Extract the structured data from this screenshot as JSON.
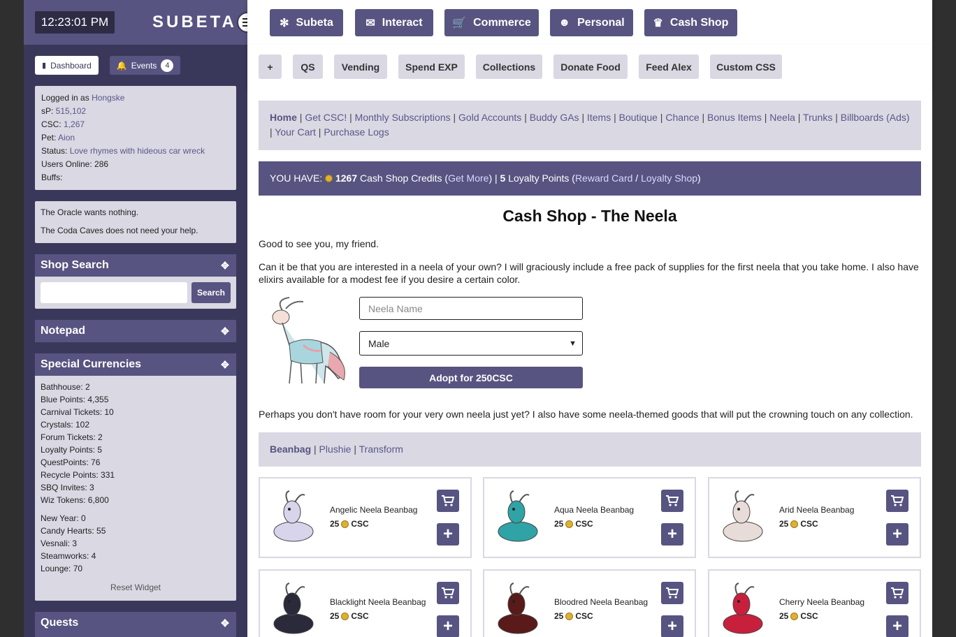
{
  "sidebar": {
    "clock": "12:23:01 PM",
    "logo": "SUBETA",
    "tab_dashboard": "Dashboard",
    "tab_events": "Events",
    "events_count": "4",
    "user_info": {
      "logged_in_prefix": "Logged in as ",
      "username": "Hongske",
      "sp_label": "sP: ",
      "sp": "515,102",
      "csc_label": "CSC: ",
      "csc": "1,267",
      "pet_label": "Pet: ",
      "pet": "Aion",
      "status_label": "Status: ",
      "status": "Love rhymes with hideous car wreck",
      "users_online": "Users Online: 286",
      "buffs": "Buffs:"
    },
    "oracle": "The Oracle wants nothing.",
    "coda": "The Coda Caves does not need your help.",
    "shop_search_title": "Shop Search",
    "search_button": "Search",
    "notepad_title": "Notepad",
    "special_currencies_title": "Special Currencies",
    "currencies": [
      "Bathhouse: 2",
      "Blue Points: 4,355",
      "Carnival Tickets: 10",
      "Crystals: 102",
      "Forum Tickets: 2",
      "Loyalty Points: 5",
      "QuestPoints: 76",
      "Recycle Points: 331",
      "SBQ Invites: 3",
      "Wiz Tokens: 6,800"
    ],
    "event_currencies": [
      "New Year: 0",
      "Candy Hearts: 55",
      "Vesnali: 3",
      "Steamworks: 4",
      "Lounge: 70"
    ],
    "reset_widget": "Reset Widget",
    "quests_title": "Quests"
  },
  "nav": {
    "items": [
      "Subeta",
      "Interact",
      "Commerce",
      "Personal",
      "Cash Shop"
    ]
  },
  "subnav": {
    "items": [
      "+",
      "QS",
      "Vending",
      "Spend EXP",
      "Collections",
      "Donate Food",
      "Feed Alex",
      "Custom CSS"
    ]
  },
  "breadcrumbs": {
    "items": [
      "Home",
      "Get CSC!",
      "Monthly Subscriptions",
      "Gold Accounts",
      "Buddy GAs",
      "Items",
      "Boutique",
      "Chance",
      "Bonus Items",
      "Neela",
      "Trunks",
      "Billboards (Ads)",
      "Your Cart",
      "Purchase Logs"
    ]
  },
  "balance": {
    "prefix": "YOU HAVE: ",
    "credits": "1267",
    "credits_label": " Cash Shop Credits (",
    "get_more": "Get More",
    "mid": ") | ",
    "loyalty": "5",
    "loyalty_label": " Loyalty Points (",
    "reward_card": "Reward Card",
    "slash": " / ",
    "loyalty_shop": "Loyalty Shop",
    "close": ")"
  },
  "page": {
    "title": "Cash Shop - The Neela",
    "greeting": "Good to see you, my friend.",
    "intro": "Can it be that you are interested in a neela of your own? I will graciously include a free pack of supplies for the first neela that you take home. I also have elixirs available for a modest fee if you desire a certain color.",
    "name_placeholder": "Neela Name",
    "gender_selected": "Male",
    "adopt_button": "Adopt for 250CSC",
    "goods_intro": "Perhaps you don't have room for your very own neela just yet? I also have some neela-themed goods that will put the crowning touch on any collection."
  },
  "categories": {
    "active": "Beanbag",
    "others": [
      "Plushie",
      "Transform"
    ]
  },
  "products": [
    {
      "name": "Angelic Neela Beanbag",
      "price": "25",
      "currency": "CSC",
      "color": "#d8d4ec"
    },
    {
      "name": "Aqua Neela Beanbag",
      "price": "25",
      "currency": "CSC",
      "color": "#2fa3a6"
    },
    {
      "name": "Arid Neela Beanbag",
      "price": "25",
      "currency": "CSC",
      "color": "#e8dcd8"
    },
    {
      "name": "Blacklight Neela Beanbag",
      "price": "25",
      "currency": "CSC",
      "color": "#2a2a3a"
    },
    {
      "name": "Bloodred Neela Beanbag",
      "price": "25",
      "currency": "CSC",
      "color": "#5a1a1a"
    },
    {
      "name": "Cherry Neela Beanbag",
      "price": "25",
      "currency": "CSC",
      "color": "#c8203c"
    }
  ],
  "colors": {
    "accent": "#575481",
    "sidebar_bg": "#3a385a",
    "panel_bg": "#d9d8e3"
  }
}
